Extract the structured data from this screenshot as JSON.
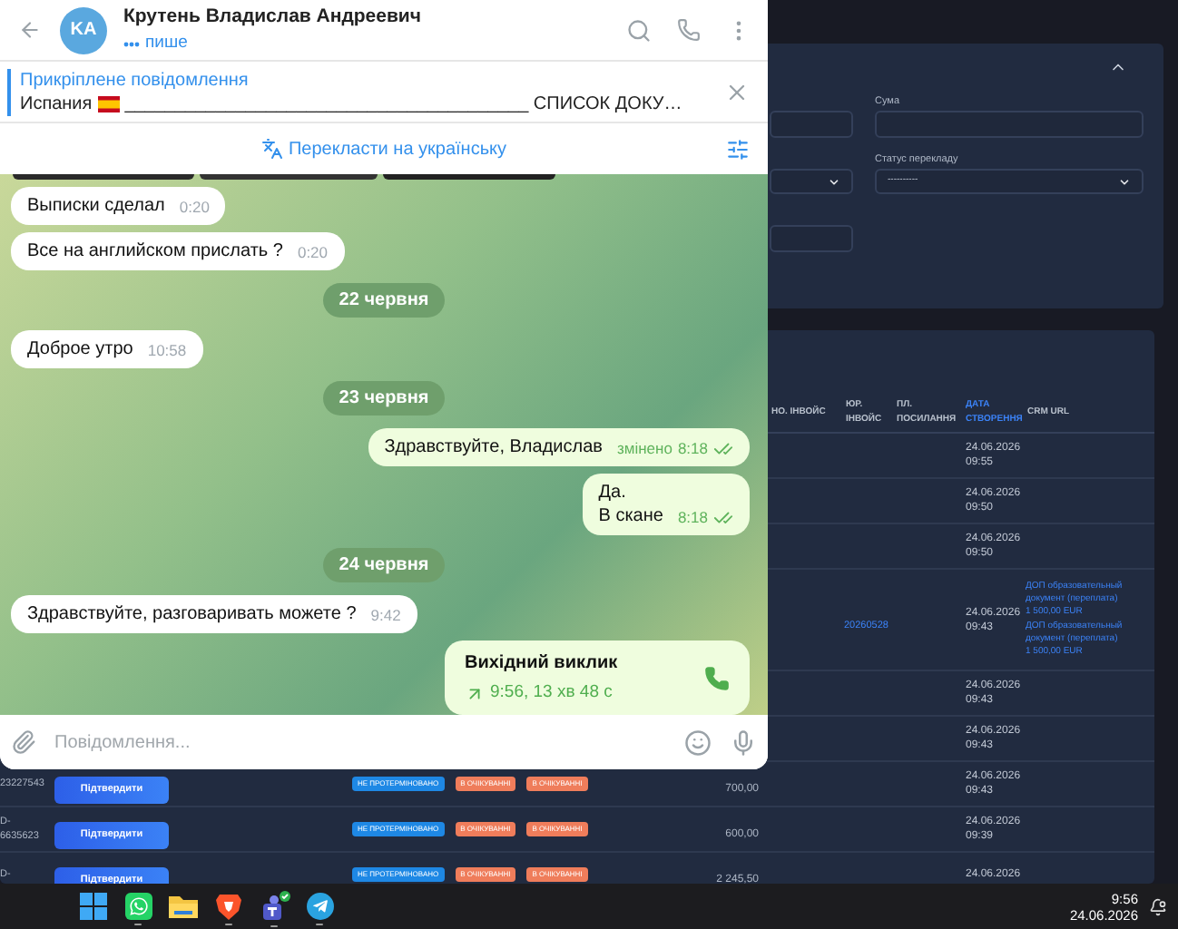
{
  "telegram": {
    "header": {
      "avatar_initials": "KA",
      "name": "Крутень Владислав Андреевич",
      "status": "пише"
    },
    "pinned": {
      "title": "Прикріплене повідомлення",
      "lead": "Испания",
      "text": "________________________________________ СПИСОК ДОКУ…"
    },
    "translate_label": "Перекласти на українську",
    "messages": [
      {
        "kind": "incoming",
        "text": "Выписки сделал",
        "time": "0:20"
      },
      {
        "kind": "incoming",
        "text": "Все на английском прислать ?",
        "time": "0:20"
      },
      {
        "kind": "date",
        "text": "22 червня"
      },
      {
        "kind": "incoming",
        "text": "Доброе утро",
        "time": "10:58"
      },
      {
        "kind": "date",
        "text": "23 червня"
      },
      {
        "kind": "outgoing",
        "text": "Здравствуйте, Владислав",
        "edited": "змінено",
        "time": "8:18",
        "read": true
      },
      {
        "kind": "outgoing",
        "text": "Да.\nВ скане",
        "time": "8:18",
        "read": true
      },
      {
        "kind": "date",
        "text": "24 червня"
      },
      {
        "kind": "incoming",
        "text": "Здравствуйте, разговаривать можете ?",
        "time": "9:42"
      },
      {
        "kind": "call",
        "title": "Вихідний виклик",
        "detail": "9:56, 13 хв 48 с"
      }
    ],
    "composer": {
      "placeholder": "Повідомлення..."
    }
  },
  "admin": {
    "filters": [
      {
        "kind": "input"
      },
      {
        "kind": "input",
        "label": "Сума"
      },
      {
        "kind": "select"
      },
      {
        "kind": "select",
        "label": "Статус перекладу",
        "value": "----------"
      },
      {
        "kind": "input"
      }
    ],
    "table": {
      "columns": [
        {
          "label": "НО. ІНВОЙС",
          "sorted": false
        },
        {
          "label": "ЮР. ІНВОЙС",
          "sorted": false
        },
        {
          "label": "ПЛ. ПОСИЛАННЯ",
          "sorted": false
        },
        {
          "label": "ДАТА СТВОРЕННЯ",
          "sorted": true
        },
        {
          "label": "CRM URL",
          "sorted": false
        }
      ],
      "rows": [
        {
          "date": "24.06.2026",
          "time": "09:55"
        },
        {
          "date": "24.06.2026",
          "time": "09:50"
        },
        {
          "date": "24.06.2026",
          "time": "09:50"
        },
        {
          "date": "24.06.2026",
          "time": "09:43",
          "legal_invoice": "20260528",
          "crm": [
            "ДОП образовательный документ (переплата) 1 500,00 EUR",
            "ДОП образовательный документ (переплата) 1 500,00 EUR"
          ]
        },
        {
          "date": "24.06.2026",
          "time": "09:43"
        },
        {
          "date": "24.06.2026",
          "time": "09:43"
        },
        {
          "id": "23227543",
          "action": "Підтвердити",
          "badges": [
            {
              "text": "НЕ ПРОТЕРМІНОВАНО",
              "color": "#1e88e5"
            },
            {
              "text": "В ОЧІКУВАННІ",
              "color": "#ef7d5b"
            },
            {
              "text": "В ОЧІКУВАННІ",
              "color": "#ef7d5b"
            }
          ],
          "amount": "700,00",
          "date": "24.06.2026",
          "time": "09:43"
        },
        {
          "id": "D-\n6635623",
          "action": "Підтвердити",
          "badges": [
            {
              "text": "НЕ ПРОТЕРМІНОВАНО",
              "color": "#1e88e5"
            },
            {
              "text": "В ОЧІКУВАННІ",
              "color": "#ef7d5b"
            },
            {
              "text": "В ОЧІКУВАННІ",
              "color": "#ef7d5b"
            }
          ],
          "amount": "600,00",
          "date": "24.06.2026",
          "time": "09:39"
        },
        {
          "id": "D-",
          "action": "Підтвердити",
          "badges": [
            {
              "text": "НЕ ПРОТЕРМІНОВАНО",
              "color": "#1e88e5"
            },
            {
              "text": "В ОЧІКУВАННІ",
              "color": "#ef7d5b"
            },
            {
              "text": "В ОЧІКУВАННІ",
              "color": "#ef7d5b"
            }
          ],
          "amount": "2 245,50",
          "date": "24.06.2026"
        }
      ]
    }
  },
  "taskbar": {
    "apps": [
      {
        "kind": "start",
        "running": false
      },
      {
        "kind": "chat",
        "running": true
      },
      {
        "kind": "folder",
        "running": false
      },
      {
        "kind": "browser",
        "running": true
      },
      {
        "kind": "teams",
        "running": true
      },
      {
        "kind": "telegram",
        "running": true
      }
    ],
    "clock": {
      "time": "9:56",
      "date": "24.06.2026"
    }
  }
}
